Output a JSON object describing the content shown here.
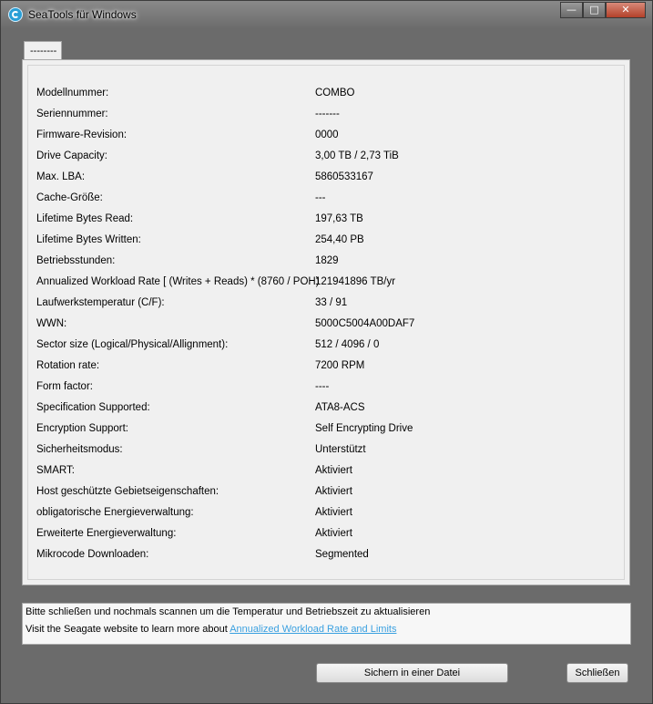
{
  "window": {
    "title": "SeaTools für Windows",
    "minimize": "—",
    "maximize": "□",
    "close": "✕"
  },
  "tab": {
    "label": "--------"
  },
  "details": [
    {
      "label": "Modellnummer:",
      "value": "COMBO"
    },
    {
      "label": "Seriennummer:",
      "value": "-------"
    },
    {
      "label": "Firmware-Revision:",
      "value": "0000"
    },
    {
      "label": "Drive Capacity:",
      "value": "3,00 TB / 2,73 TiB"
    },
    {
      "label": "Max. LBA:",
      "value": "5860533167"
    },
    {
      "label": "Cache-Größe:",
      "value": "---"
    },
    {
      "label": "Lifetime Bytes Read:",
      "value": "197,63  TB"
    },
    {
      "label": "Lifetime Bytes Written:",
      "value": "254,40  PB"
    },
    {
      "label": "Betriebsstunden:",
      "value": "1829"
    },
    {
      "label": "Annualized Workload Rate [ (Writes + Reads) * (8760 / POH)",
      "value": "121941896 TB/yr"
    },
    {
      "label": "Laufwerkstemperatur (C/F):",
      "value": "33 / 91"
    },
    {
      "label": "WWN:",
      "value": "5000C5004A00DAF7"
    },
    {
      "label": "Sector size (Logical/Physical/Allignment):",
      "value": "512 / 4096 / 0"
    },
    {
      "label": "Rotation rate:",
      "value": "7200 RPM"
    },
    {
      "label": "Form factor:",
      "value": "----"
    },
    {
      "label": "Specification Supported:",
      "value": "ATA8-ACS"
    },
    {
      "label": "Encryption Support:",
      "value": "Self Encrypting Drive"
    },
    {
      "label": "Sicherheitsmodus:",
      "value": "Unterstützt"
    },
    {
      "label": "SMART:",
      "value": "Aktiviert"
    },
    {
      "label": "Host geschützte Gebietseigenschaften:",
      "value": "Aktiviert"
    },
    {
      "label": "obligatorische Energieverwaltung:",
      "value": "Aktiviert"
    },
    {
      "label": "Erweiterte Energieverwaltung:",
      "value": "Aktiviert"
    },
    {
      "label": "Mikrocode  Downloaden:",
      "value": "Segmented"
    }
  ],
  "info": {
    "line1": "Bitte schließen und nochmals scannen um die Temperatur und Betriebszeit zu aktualisieren",
    "line2_prefix": "Visit the Seagate website to learn more about ",
    "line2_link": "Annualized Workload Rate and Limits"
  },
  "buttons": {
    "save": "Sichern in einer Datei",
    "close": "Schließen"
  }
}
